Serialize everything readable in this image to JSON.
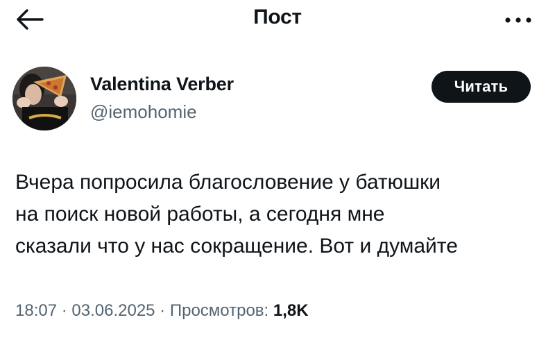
{
  "header": {
    "title": "Пост",
    "back_icon": "arrow-left-icon",
    "more_icon": "more-horizontal-icon"
  },
  "author": {
    "name": "Valentina Verber",
    "handle": "@iemohomie",
    "avatar_icon": "profile-photo"
  },
  "follow_button": {
    "label": "Читать"
  },
  "post": {
    "lines": [
      "Вчера попросила благословение у батюшки",
      "на поиск новой работы, а сегодня мне",
      "сказали что у нас сокращение. Вот и думайте"
    ]
  },
  "meta": {
    "time": "18:07",
    "separator": " · ",
    "date": "03.06.2025",
    "views_label": "Просмотров:",
    "views_count": "1,8K"
  },
  "colors": {
    "text": "#0f1419",
    "secondary": "#536471",
    "button_bg": "#0f1419",
    "button_text": "#ffffff",
    "background": "#ffffff"
  }
}
